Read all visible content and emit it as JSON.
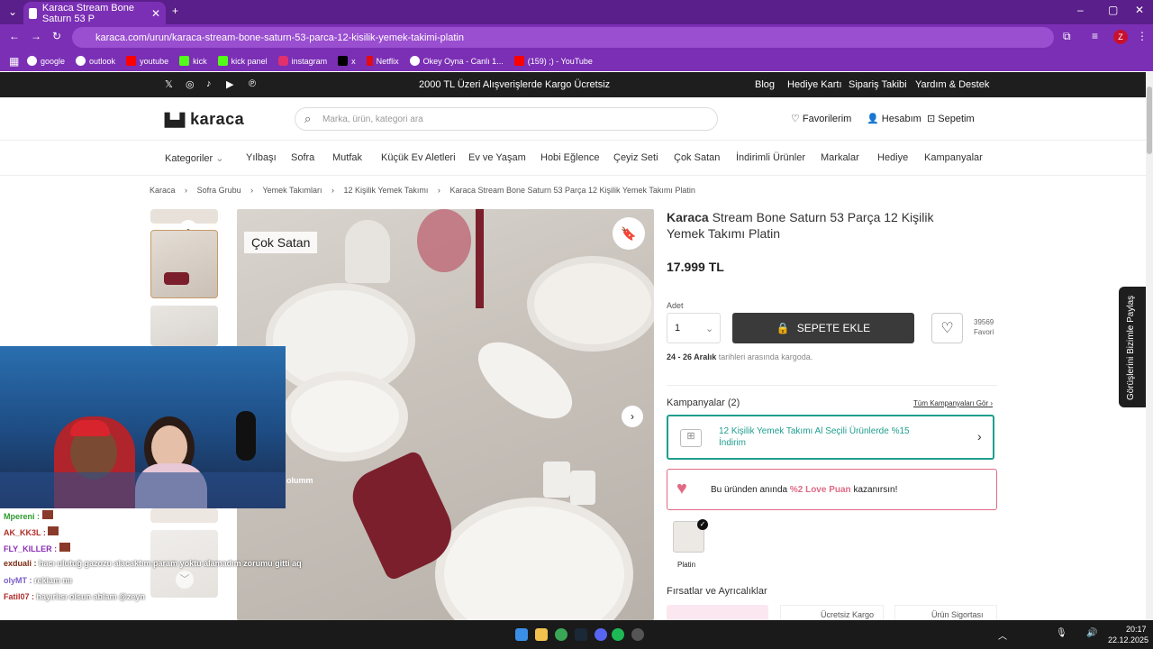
{
  "browser": {
    "tab_title": "Karaca Stream Bone Saturn 53 P",
    "url": "karaca.com/urun/karaca-stream-bone-saturn-53-parca-12-kisilik-yemek-takimi-platin",
    "profile_letter": "Z",
    "bookmarks": [
      "google",
      "outlook",
      "youtube",
      "kick",
      "kick panel",
      "instagram",
      "x",
      "Netflix",
      "Okey Oyna - Canlı 1...",
      "(159) ;) - YouTube"
    ]
  },
  "topstrip": {
    "promo": "2000 TL Üzeri Alışverişlerde Kargo Ücretsiz",
    "links": [
      "Blog",
      "Hediye Kartı",
      "Sipariş Takibi",
      "Yardım & Destek"
    ]
  },
  "header": {
    "logo": "karaca",
    "search_placeholder": "Marka, ürün, kategori ara",
    "favorites": "Favorilerim",
    "account": "Hesabım",
    "cart": "Sepetim"
  },
  "nav": [
    "Kategoriler",
    "Yılbaşı",
    "Sofra",
    "Mutfak",
    "Küçük Ev Aletleri",
    "Ev ve Yaşam",
    "Hobi Eğlence",
    "Çeyiz Seti",
    "Çok Satan",
    "İndirimli Ürünler",
    "Markalar",
    "Hediye",
    "Kampanyalar"
  ],
  "breadcrumb": [
    "Karaca",
    "Sofra Grubu",
    "Yemek Takımları",
    "12 Kişilik Yemek Takımı",
    "Karaca Stream Bone Saturn 53 Parça 12 Kişilik Yemek Takımı Platin"
  ],
  "product": {
    "badge": "Çok Satan",
    "brand": "Karaca",
    "title": " Stream Bone Saturn 53 Parça 12 Kişilik Yemek Takımı Platin",
    "price": "17.999 TL",
    "qty_label": "Adet",
    "qty_value": "1",
    "add_to_cart": "SEPETE EKLE",
    "fav_count": "39569",
    "fav_label": "Favori",
    "delivery_date": "24 - 26 Aralık",
    "delivery_text": " tarihleri arasında kargoda.",
    "campaigns_title": "Kampanyalar (2)",
    "campaigns_all": "Tüm Kampanyaları Gör",
    "campaign_text": "12 Kişilik Yemek Takımı Al Seçili Ürünlerde %15 İndirim",
    "love_text_1": "Bu üründen anında ",
    "love_pct": "%2 Love Puan",
    "love_text_2": " kazanırsın!",
    "variant": "Platin",
    "opportunities": "Fırsatlar ve Ayrıcalıklar",
    "opp_1": "Ücretsiz Kargo",
    "opp_2": "Ürün Sigortası"
  },
  "side_tab": "Görüşlerini Bizimle Paylaş",
  "chat": [
    {
      "user": "Mpereni :",
      "msg": "",
      "color": "#2e9b2e"
    },
    {
      "user": "AK_KK3L :",
      "msg": "",
      "color": "#b0302a"
    },
    {
      "user": "FLY_KILLER :",
      "msg": "",
      "color": "#8a2fb5"
    },
    {
      "user": "exduali :",
      "msg": "hacı ulutuğ gazozu alacaktım param yoktu alamadım zorumu gitti aq",
      "color": "#7a2a10"
    },
    {
      "user": "olyMT :",
      "msg": "reklam mı",
      "color": "#7b5fc8"
    },
    {
      "user": "Fatil07 :",
      "msg": "hayırlısı olsun ablam @zeyn",
      "color": "#b02a2a"
    }
  ],
  "taskbar": {
    "time": "20:17",
    "date": "22.12.2025"
  }
}
